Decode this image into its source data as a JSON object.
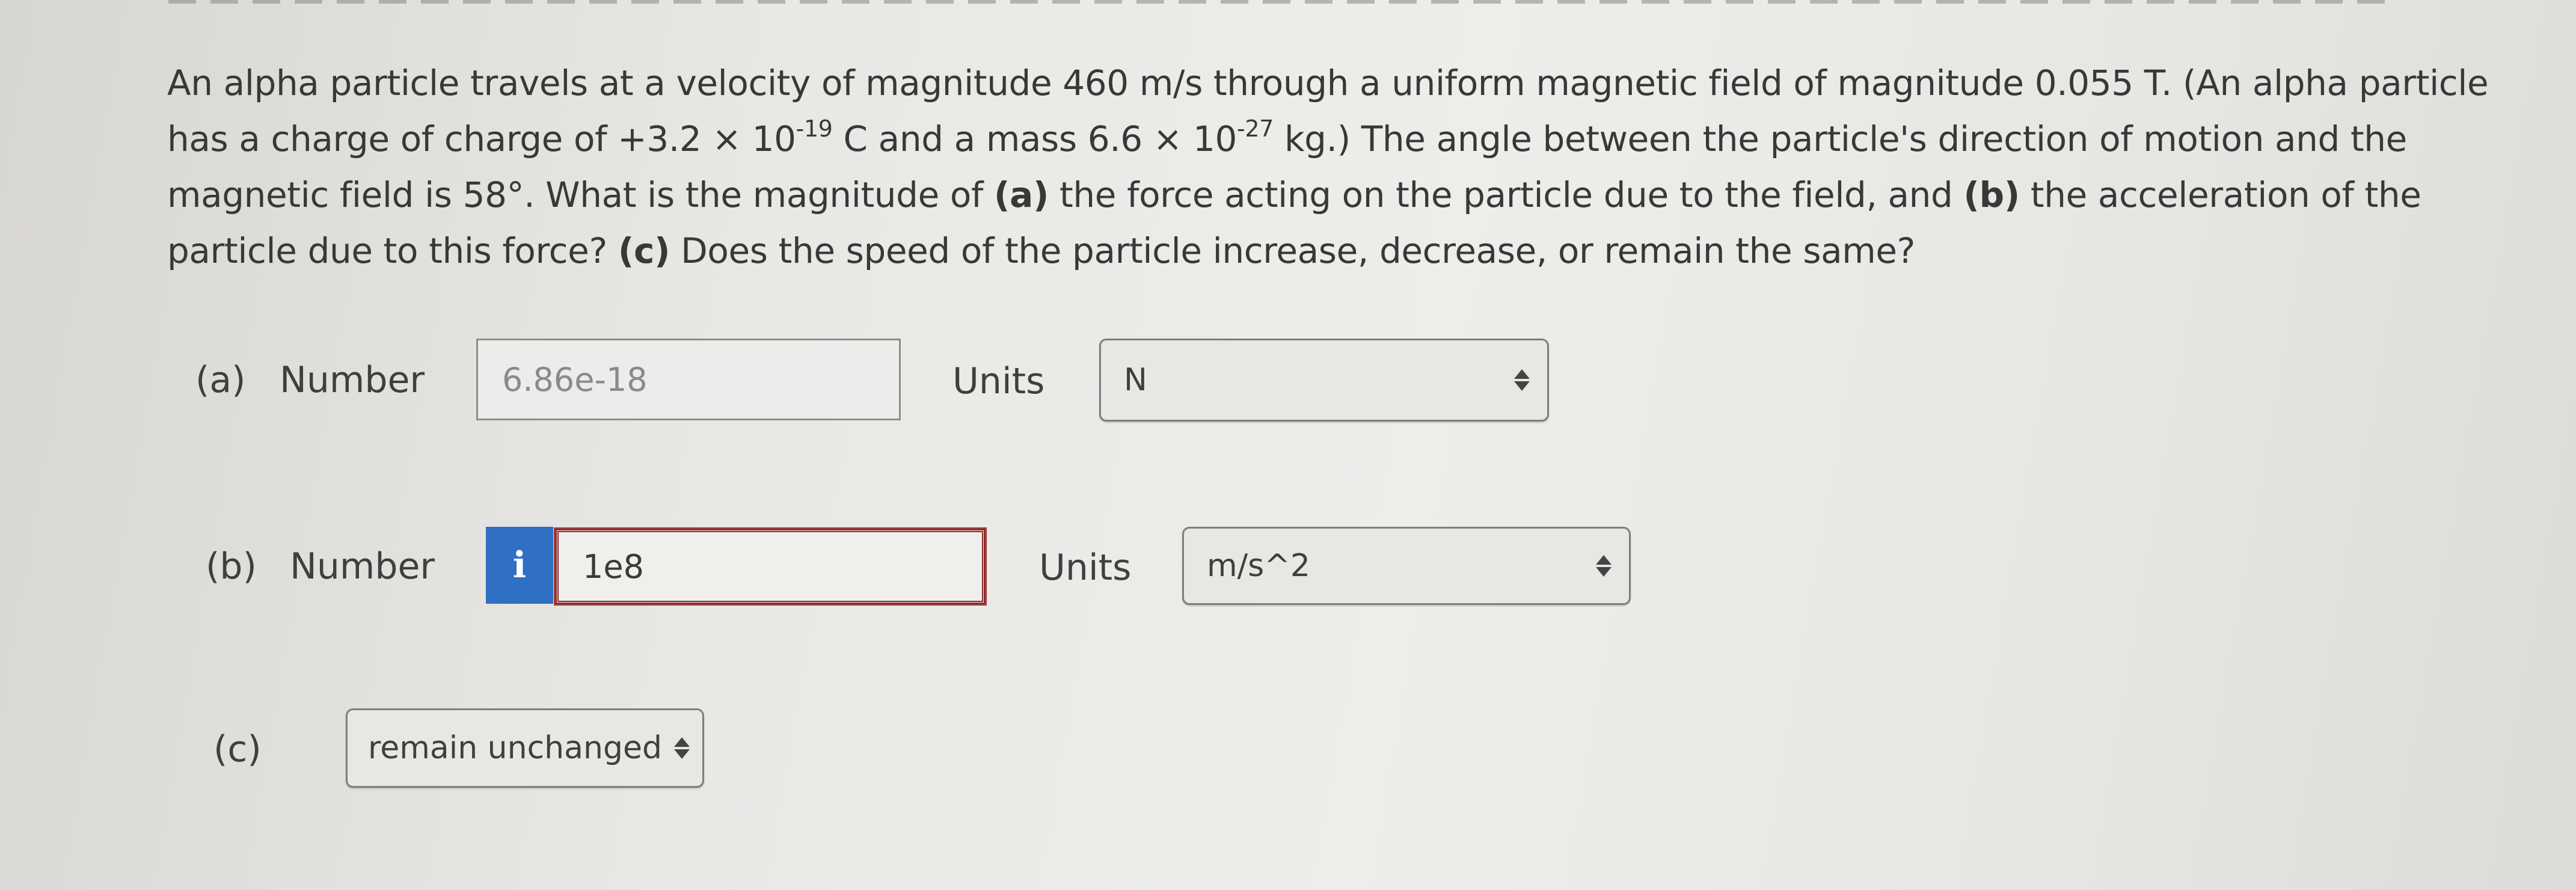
{
  "question": {
    "line1": "An alpha particle travels at a velocity of magnitude 460 m/s through a uniform magnetic field of magnitude 0.055 T. (An alpha particle",
    "line2_a": "has a charge of charge of +3.2 × 10",
    "line2_exp1": "-19",
    "line2_b": " C and a mass 6.6 × 10",
    "line2_exp2": "-27",
    "line2_c": " kg.) The angle between the particle's direction of motion and the",
    "line3_a": "magnetic field is 58°. What is the magnitude of ",
    "part_a_tag": "(a)",
    "line3_b": " the force acting on the particle due to the field, and ",
    "part_b_tag": "(b)",
    "line3_c": " the acceleration of the",
    "line4_a": "particle due to this force? ",
    "part_c_tag": "(c)",
    "line4_b": " Does the speed of the particle increase, decrease, or remain the same?"
  },
  "part_a": {
    "label": "(a)",
    "number_label": "Number",
    "value": "6.86e-18",
    "units_label": "Units",
    "unit": "N"
  },
  "part_b": {
    "label": "(b)",
    "number_label": "Number",
    "info_icon": "i",
    "value": "1e8",
    "units_label": "Units",
    "unit": "m/s^2"
  },
  "part_c": {
    "label": "(c)",
    "selection": "remain unchanged"
  },
  "colors": {
    "info_button": "#2f6fc4",
    "error_border": "#8a2a2a"
  }
}
